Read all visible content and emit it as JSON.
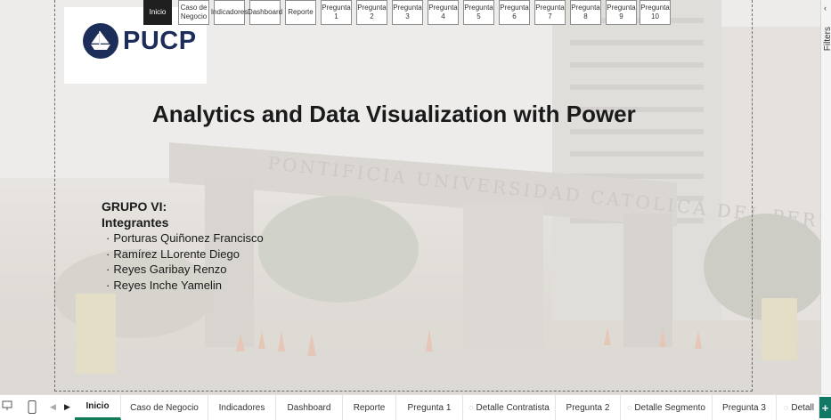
{
  "nav_buttons": [
    {
      "label": "Inicio",
      "active": true
    },
    {
      "label": "Caso de Negocio",
      "active": false
    },
    {
      "label": "Indicadores",
      "active": false
    },
    {
      "label": "Dashboard",
      "active": false
    },
    {
      "label": "Reporte",
      "active": false
    },
    {
      "label": "Pregunta 1",
      "active": false
    },
    {
      "label": "Pregunta 2",
      "active": false
    },
    {
      "label": "Pregunta 3",
      "active": false
    },
    {
      "label": "Pregunta 4",
      "active": false
    },
    {
      "label": "Pregunta 5",
      "active": false
    },
    {
      "label": "Pregunta 6",
      "active": false
    },
    {
      "label": "Pregunta 7",
      "active": false
    },
    {
      "label": "Pregunta 8",
      "active": false
    },
    {
      "label": "Pregunta 9",
      "active": false
    },
    {
      "label": "Pregunta 10",
      "active": false
    }
  ],
  "logo": {
    "text": "PUCP",
    "emblem_icon": "ship-shield-icon"
  },
  "slide": {
    "title": "Analytics and Data Visualization with Power",
    "group": "GRUPO VI:",
    "members_heading": "Integrantes",
    "members": [
      "Porturas Quiñonez Francisco",
      "Ramírez LLorente Diego",
      "Reyes Garibay Renzo",
      "Reyes Inche Yamelin"
    ]
  },
  "background": {
    "sign_text": "PONTIFICIA UNIVERSIDAD CATOLICA DEL PERU"
  },
  "filters_pane": {
    "label": "Filters",
    "expand_icon": "chevron-left-icon"
  },
  "bottom_bar": {
    "tabs": [
      {
        "label": "Inicio",
        "active": true,
        "hidden": false
      },
      {
        "label": "Caso de Negocio",
        "active": false,
        "hidden": false
      },
      {
        "label": "Indicadores",
        "active": false,
        "hidden": false
      },
      {
        "label": "Dashboard",
        "active": false,
        "hidden": false
      },
      {
        "label": "Reporte",
        "active": false,
        "hidden": false
      },
      {
        "label": "Pregunta 1",
        "active": false,
        "hidden": false
      },
      {
        "label": "Detalle Contratista",
        "active": false,
        "hidden": true
      },
      {
        "label": "Pregunta 2",
        "active": false,
        "hidden": false
      },
      {
        "label": "Detalle Segmento",
        "active": false,
        "hidden": true
      },
      {
        "label": "Pregunta 3",
        "active": false,
        "hidden": false
      },
      {
        "label": "Detall",
        "active": false,
        "hidden": true
      }
    ],
    "add_label": "+",
    "icons": [
      "desktop-view-icon",
      "mobile-view-icon",
      "prev-page-icon",
      "next-page-icon"
    ],
    "accent": "#127c5a"
  }
}
